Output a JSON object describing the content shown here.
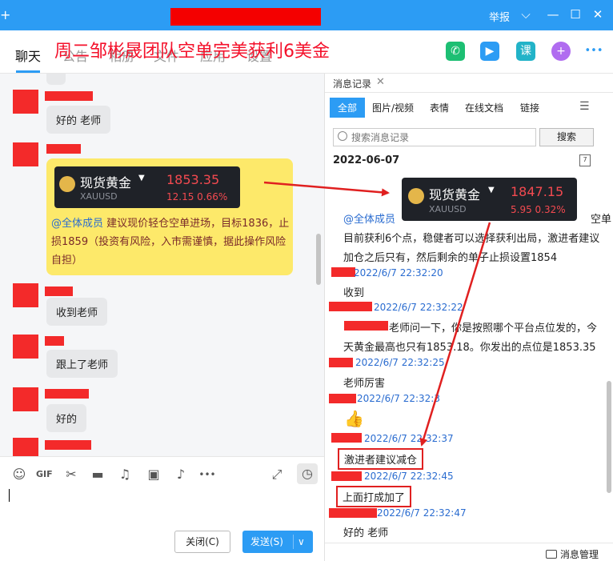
{
  "titlebar": {
    "left_glyph": "+",
    "report": "举报",
    "chevron": "⌵",
    "minimize": "—",
    "maximize": "☐",
    "close": "✕"
  },
  "headline": "周二邹彬晟团队空单完美获利6美金",
  "tabs": [
    {
      "label": "聊天",
      "active": true
    },
    {
      "label": "公告"
    },
    {
      "label": "相册"
    },
    {
      "label": "文件"
    },
    {
      "label": "应用"
    },
    {
      "label": "设置"
    }
  ],
  "top_icons": [
    {
      "name": "phone-icon",
      "glyph": "✆",
      "color": "#1dbf73"
    },
    {
      "name": "video-icon",
      "glyph": "▶",
      "color": "#2c9cf4"
    },
    {
      "name": "course-icon",
      "glyph": "课",
      "color": "#22b3c8"
    },
    {
      "name": "plus-icon",
      "glyph": "+",
      "color": "#b06cf0"
    },
    {
      "name": "more-icon",
      "glyph": "•••",
      "color": "#ffffff"
    }
  ],
  "chat": {
    "messages": [
      {
        "text": "好的  老师"
      },
      {
        "text": "收到老师"
      },
      {
        "text": "跟上了老师"
      },
      {
        "text": "好的"
      }
    ],
    "quote": {
      "name": "现货黄金",
      "code": "XAUUSD",
      "price": "1853.35",
      "change": "12.15   0.66%"
    },
    "announcement_at": "@全体成员",
    "announcement_body": "  建议现价轻仓空单进场，目标1836，止损1859（投资有风险，入市需谨慎，据此操作风险自担）"
  },
  "toolbar": {
    "tools": [
      "☺",
      "GIF",
      "✂",
      "▬",
      "♫",
      "▣",
      "♪",
      "•••"
    ],
    "expand": "⤢",
    "history": "◷"
  },
  "buttons": {
    "close": "关闭(C)",
    "send": "发送(S)",
    "send_arrow": "∨"
  },
  "history": {
    "tab_label": "消息记录",
    "tab_close": "✕",
    "filters": [
      "全部",
      "图片/视频",
      "表情",
      "在线文档",
      "链接"
    ],
    "filter_icon": "☰",
    "search_placeholder": "搜索消息记录",
    "search_button": "搜索",
    "date": "2022-06-07",
    "cal_glyph": "7",
    "quote": {
      "name": "现货黄金",
      "code": "XAUUSD",
      "price": "1847.15",
      "change": "5.95   0.32%"
    },
    "entries": [
      {
        "at": "@全体成员",
        "tail": "空单"
      },
      {
        "line": "目前获利6个点，稳健者可以选择获利出局，激进者建议"
      },
      {
        "line": "加仓之后只有，然后剩余的单子止损设置1854"
      },
      {
        "stamp": "2022/6/7 22:32:20"
      },
      {
        "line": "收到"
      },
      {
        "stamp": "2022/6/7 22:32:22"
      },
      {
        "line": "老师问一下，你是按照哪个平台点位发的，今"
      },
      {
        "line": "天黄金最高也只有1853.18。你发出的点位是1853.35"
      },
      {
        "stamp": "2022/6/7 22:32:25"
      },
      {
        "line": "老师厉害"
      },
      {
        "stamp": "2022/6/7 22:32:3"
      },
      {
        "thumb": "👍"
      },
      {
        "stamp": "2022/6/7 22:32:37"
      },
      {
        "boxed": "激进者建议减仓"
      },
      {
        "stamp": "2022/6/7 22:32:45"
      },
      {
        "boxed": "上面打成加了"
      },
      {
        "stamp": "2022/6/7 22:32:47"
      },
      {
        "line": "好的  老师"
      }
    ],
    "manage": "消息管理"
  }
}
